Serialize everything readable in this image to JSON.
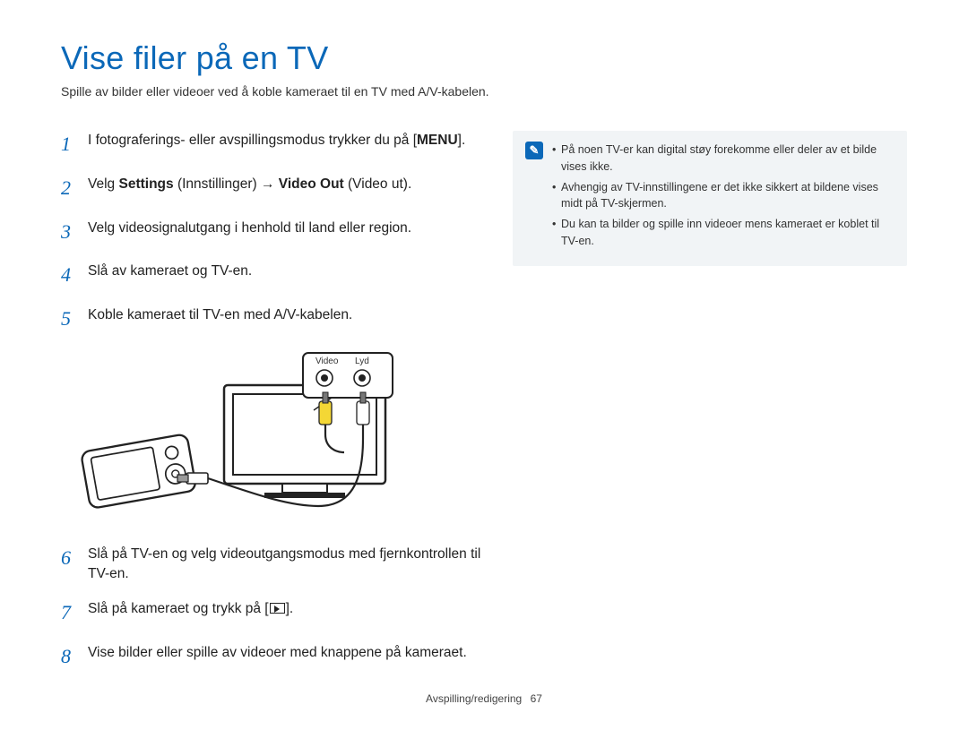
{
  "title": "Vise filer på en TV",
  "subtitle": "Spille av bilder eller videoer ved å koble kameraet til en TV med A/V-kabelen.",
  "steps": {
    "s1a": "I fotograferings- eller avspillingsmodus trykker du på [",
    "s1b": "MENU",
    "s1c": "].",
    "s2a": "Velg ",
    "s2b": "Settings",
    "s2c": " (Innstillinger) → ",
    "s2d": "Video Out",
    "s2e": " (Video ut).",
    "s3": "Velg videosignalutgang i henhold til land eller region.",
    "s4": "Slå av kameraet og TV-en.",
    "s5": "Koble kameraet til TV-en med A/V-kabelen.",
    "s6": "Slå på TV-en og velg videoutgangsmodus med fjernkontrollen til TV-en.",
    "s7a": "Slå på kameraet og trykk på [",
    "s7b": "].",
    "s8": "Vise bilder eller spille av videoer med knappene på kameraet."
  },
  "nums": {
    "n1": "1",
    "n2": "2",
    "n3": "3",
    "n4": "4",
    "n5": "5",
    "n6": "6",
    "n7": "7",
    "n8": "8"
  },
  "diagram": {
    "video": "Video",
    "audio": "Lyd"
  },
  "notes": {
    "n1": "På noen TV-er kan digital støy forekomme eller deler av et bilde vises ikke.",
    "n2": "Avhengig av TV-innstillingene er det ikke sikkert at bildene vises midt på TV-skjermen.",
    "n3": "Du kan ta bilder og spille inn videoer mens kameraet er koblet til TV-en."
  },
  "footer": {
    "section": "Avspilling/redigering",
    "page": "67"
  }
}
